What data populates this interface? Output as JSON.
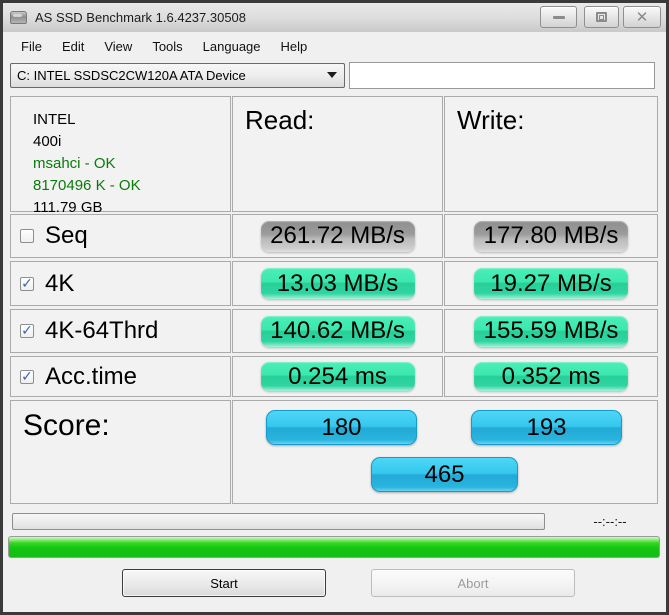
{
  "window": {
    "title": "AS SSD Benchmark 1.6.4237.30508"
  },
  "menu": {
    "items": [
      "File",
      "Edit",
      "View",
      "Tools",
      "Language",
      "Help"
    ]
  },
  "toolbar": {
    "drive_selected": "C: INTEL SSDSC2CW120A ATA Device",
    "search_value": ""
  },
  "drive_info": {
    "vendor": "INTEL",
    "firmware": "400i",
    "driver_status": "msahci - OK",
    "offset_status": "8170496 K - OK",
    "capacity": "111.79 GB"
  },
  "results": {
    "read_header": "Read:",
    "write_header": "Write:",
    "rows": [
      {
        "label": "Seq",
        "check": "",
        "read": "261.72 MB/s",
        "write": "177.80 MB/s"
      },
      {
        "label": "4K",
        "check": "✓",
        "read": "13.03 MB/s",
        "write": "19.27 MB/s"
      },
      {
        "label": "4K-64Thrd",
        "check": "✓",
        "read": "140.62 MB/s",
        "write": "155.59 MB/s"
      },
      {
        "label": "Acc.time",
        "check": "✓",
        "read": "0.254 ms",
        "write": "0.352 ms"
      }
    ],
    "score": {
      "label": "Score:",
      "read_score": "180",
      "write_score": "193",
      "total_score": "465"
    }
  },
  "footer": {
    "elapsed_time": "--:--:--",
    "start_label": "Start",
    "abort_label": "Abort"
  },
  "colors": {
    "pill_gray": "#9b9b9b",
    "pill_green": "#2fd9a2",
    "pill_blue": "#29bde8",
    "progress_green": "#14c512",
    "ok_text": "#0a7a0a",
    "accent_check": "#3d64a8"
  }
}
